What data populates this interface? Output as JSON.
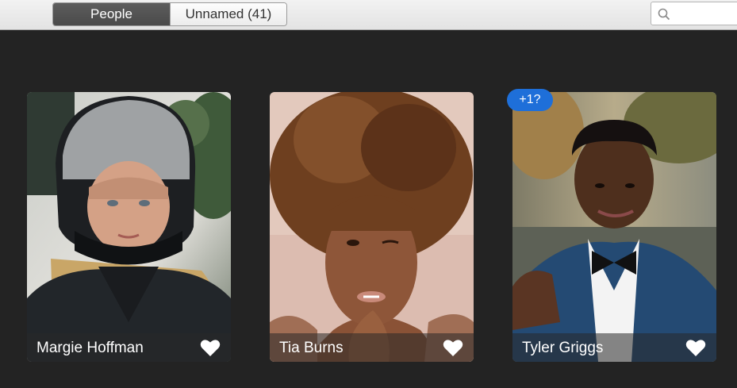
{
  "toolbar": {
    "tabs": [
      {
        "label": "People",
        "active": true
      },
      {
        "label": "Unnamed (41)",
        "active": false
      }
    ],
    "search": {
      "placeholder": "",
      "value": ""
    }
  },
  "people": [
    {
      "name": "Margie Hoffman",
      "favorite": true
    },
    {
      "name": "Tia Burns",
      "favorite": true
    },
    {
      "name": "Tyler Griggs",
      "favorite": true,
      "badge": "+1?"
    }
  ],
  "colors": {
    "background": "#232323",
    "badge": "#1e6fd9",
    "active_tab": "#4a4a4a"
  }
}
